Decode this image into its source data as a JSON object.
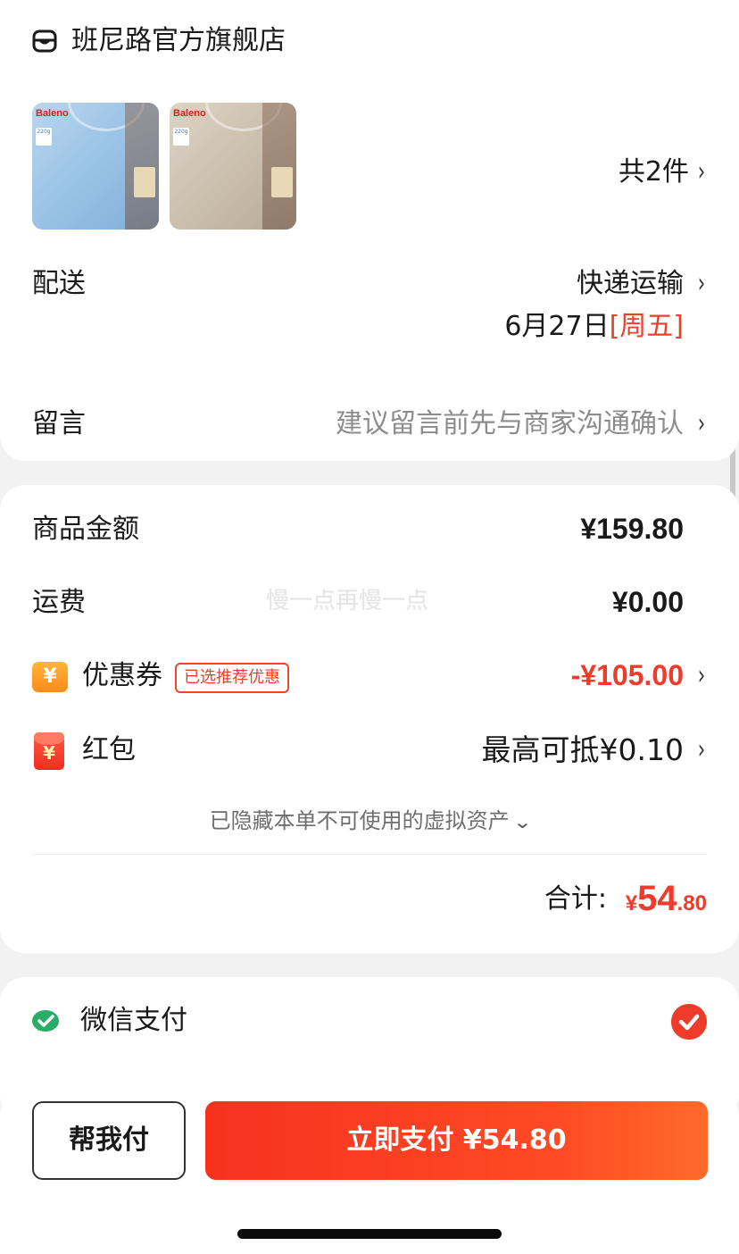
{
  "store": {
    "name": "班尼路官方旗舰店"
  },
  "products": {
    "thumbs": [
      {
        "brand": "Baleno",
        "tag": "220g",
        "color": "#9cc4e6"
      },
      {
        "brand": "Baleno",
        "tag": "220g",
        "color": "#cbbfae"
      }
    ],
    "count_label": "共2件"
  },
  "delivery": {
    "label": "配送",
    "method": "快递运输",
    "date": "6月27日",
    "weekday": "[周五]"
  },
  "message": {
    "label": "留言",
    "placeholder": "建议留言前先与商家沟通确认"
  },
  "summary": {
    "goods_label": "商品金额",
    "goods_value": "¥159.80",
    "shipping_label": "运费",
    "shipping_value": "¥0.00",
    "watermark": "慢一点再慢一点",
    "coupon_icon": "¥",
    "coupon_label": "优惠券",
    "coupon_badge": "已选推荐优惠",
    "coupon_value": "-¥105.00",
    "redpacket_icon": "¥",
    "redpacket_label": "红包",
    "redpacket_value": "最高可抵¥0.10",
    "hidden_assets": "已隐藏本单不可使用的虚拟资产",
    "total_label": "合计:",
    "total_currency": "¥",
    "total_int": "54",
    "total_dec": ".80"
  },
  "payment": {
    "method": "微信支付",
    "selected": true
  },
  "actions": {
    "help_pay": "帮我付",
    "pay_now": "立即支付 ¥54.80"
  },
  "colors": {
    "accent": "#ee3b2b",
    "wechat": "#2aae67"
  }
}
